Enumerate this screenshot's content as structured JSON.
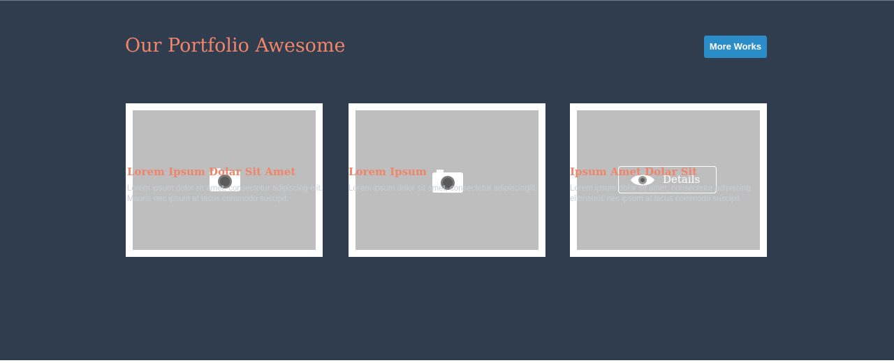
{
  "section": {
    "title": "Our Portfolio Awesome",
    "more_button_label": "More Works"
  },
  "colors": {
    "background": "#2f3d4f",
    "accent": "#f0856a",
    "button": "#2b8dc8",
    "thumbnail_placeholder": "#bebebe"
  },
  "cards": [
    {
      "title": "Lorem Ipsum Dolar Sit Amet",
      "desc_line1": "Lorem ipsum dolor sit amet, consectetur adipiscing elit.",
      "desc_line2": "Mauris nec ipsum at lacus commodo suscipit.",
      "icon": "camera-icon"
    },
    {
      "title": "Lorem Ipsum",
      "desc_line1": "Lorem ipsum dolor sit amet, consectetur adipiscinglit.",
      "desc_line2": "",
      "icon": "camera-icon"
    },
    {
      "title": "Ipsum Amet Dolar Sit",
      "desc_line1": "Lorem ipsum dolor sit amet, consectetur adipiscing",
      "desc_line2": "elitmauris nec ipsum at lacus commodo suscipit.",
      "icon": "eye-icon",
      "hover_button_label": "Details"
    }
  ]
}
